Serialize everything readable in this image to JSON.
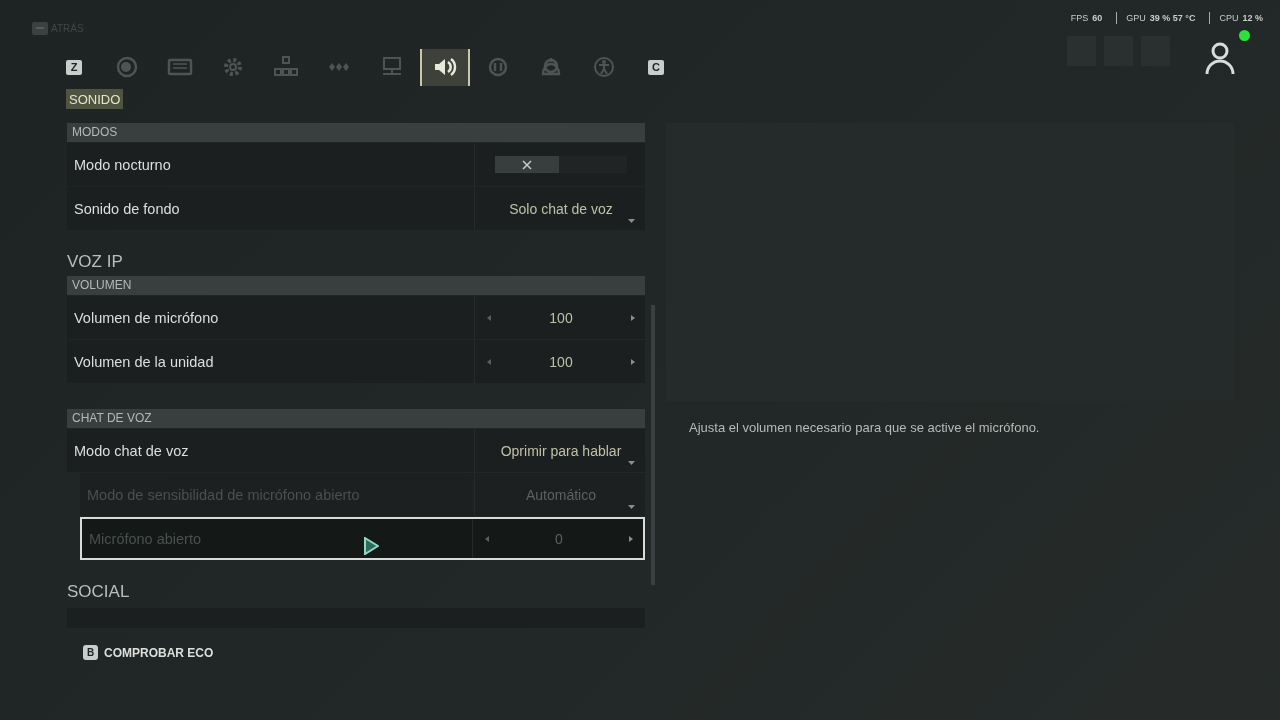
{
  "back": {
    "label": "ATRÁS"
  },
  "perf": [
    {
      "label": "FPS",
      "value": "60"
    },
    {
      "label": "GPU",
      "value": "39 % 57 °C"
    },
    {
      "label": "CPU",
      "value": "12 %"
    }
  ],
  "profile": {
    "online": true
  },
  "tabs": {
    "prev_key": "Z",
    "next_key": "C",
    "items": [
      {
        "selected": false
      },
      {
        "selected": false
      },
      {
        "selected": false
      },
      {
        "selected": false
      },
      {
        "selected": false
      },
      {
        "selected": false
      },
      {
        "selected": true
      },
      {
        "selected": false
      },
      {
        "selected": false
      },
      {
        "selected": false
      }
    ]
  },
  "page_title": "SONIDO",
  "settings": [
    {
      "kind": "group",
      "label": "MODOS"
    },
    {
      "kind": "toggle",
      "label": "Modo nocturno",
      "on": false,
      "disabled": false,
      "selected": false
    },
    {
      "kind": "dropdown",
      "label": "Sonido de fondo",
      "value": "Solo chat de voz",
      "disabled": false,
      "selected": false
    },
    {
      "kind": "section",
      "label": "VOZ IP"
    },
    {
      "kind": "group",
      "label": "VOLUMEN"
    },
    {
      "kind": "stepper",
      "label": "Volumen de micrófono",
      "value": "100",
      "disabled": false,
      "selected": false
    },
    {
      "kind": "stepper",
      "label": "Volumen de la unidad",
      "value": "100",
      "disabled": false,
      "selected": false
    },
    {
      "kind": "group",
      "label": "CHAT DE VOZ"
    },
    {
      "kind": "dropdown",
      "label": "Modo chat de voz",
      "value": "Oprimir para hablar",
      "disabled": false,
      "selected": false
    },
    {
      "kind": "dropdown",
      "label": "Modo de sensibilidad de micrófono abierto",
      "value": "Automático",
      "disabled": true,
      "selected": false
    },
    {
      "kind": "stepper",
      "label": "Micrófono abierto",
      "value": "0",
      "disabled": true,
      "selected": true
    },
    {
      "kind": "section",
      "label": "SOCIAL"
    }
  ],
  "description": "Ajusta el volumen necesario para que se active el micrófono.",
  "footer": {
    "key": "B",
    "label": "COMPROBAR ECO"
  }
}
